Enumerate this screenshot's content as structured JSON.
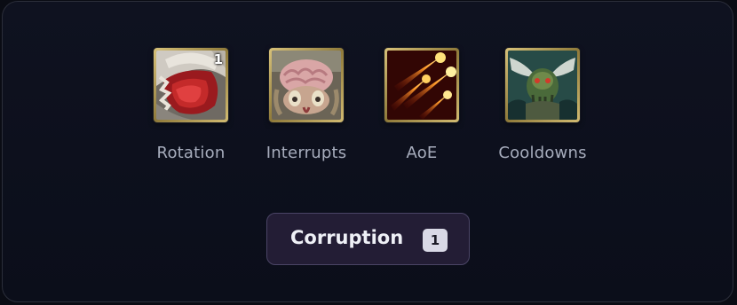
{
  "toggles": [
    {
      "label": "Rotation",
      "icon": "red-maw-icon",
      "badge": "1"
    },
    {
      "label": "Interrupts",
      "icon": "brain-creature-icon"
    },
    {
      "label": "AoE",
      "icon": "fireball-volley-icon"
    },
    {
      "label": "Cooldowns",
      "icon": "winged-beast-icon"
    }
  ],
  "corruption": {
    "label": "Corruption",
    "count": "1"
  },
  "colors": {
    "background": "#0a0c14",
    "panel_border": "#2b2e3a",
    "label_text": "#a7adbd",
    "button_bg": "#231d35",
    "button_border": "#4a4465",
    "icon_frame_gold": "#d8c27a"
  }
}
